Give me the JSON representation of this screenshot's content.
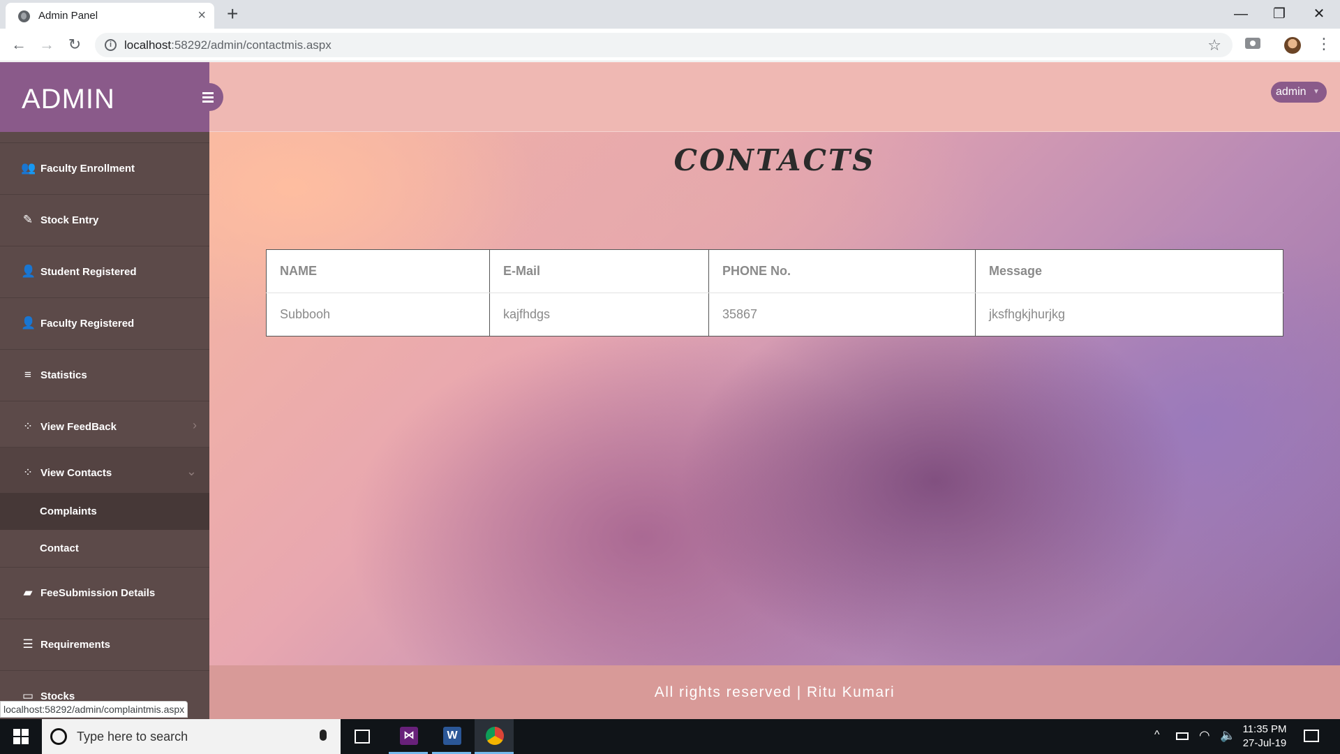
{
  "browser": {
    "tab_title": "Admin Panel",
    "tab_close": "×",
    "new_tab": "+",
    "window_min": "—",
    "window_max": "❐",
    "window_close": "✕",
    "back": "←",
    "forward": "→",
    "reload": "↻",
    "url_host": "localhost",
    "url_path": ":58292/admin/contactmis.aspx",
    "star": "☆",
    "menu": "⋮",
    "status_url": "localhost:58292/admin/complaintmis.aspx"
  },
  "sidebar": {
    "brand": "ADMIN",
    "items": [
      {
        "label": "Faculty Enrollment",
        "icon": "users-icon",
        "glyph": "👥"
      },
      {
        "label": "Stock Entry",
        "icon": "edit-icon",
        "glyph": "✎"
      },
      {
        "label": "Student Registered",
        "icon": "user-icon",
        "glyph": "👤"
      },
      {
        "label": "Faculty Registered",
        "icon": "user-plus-icon",
        "glyph": "👤"
      },
      {
        "label": "Statistics",
        "icon": "bars-icon",
        "glyph": "≡"
      },
      {
        "label": "View FeedBack",
        "icon": "grid-icon",
        "glyph": "⁘",
        "chevron": "›"
      },
      {
        "label": "View Contacts",
        "icon": "grid-icon",
        "glyph": "⁘",
        "chevron": "⌄"
      },
      {
        "label": "FeeSubmission Details",
        "icon": "book-icon",
        "glyph": "▰"
      },
      {
        "label": "Requirements",
        "icon": "list-icon",
        "glyph": "☰"
      },
      {
        "label": "Stocks",
        "icon": "briefcase-icon",
        "glyph": "▭"
      }
    ],
    "submenu": [
      {
        "label": "Complaints"
      },
      {
        "label": "Contact"
      }
    ]
  },
  "header": {
    "user": "admin",
    "caret": "▼"
  },
  "main": {
    "title": "CONTACTS",
    "table": {
      "columns": [
        "NAME",
        "E-Mail",
        "PHONE No.",
        "Message"
      ],
      "rows": [
        [
          "Subbooh",
          "kajfhdgs",
          "35867",
          "jksfhgkjhurjkg"
        ]
      ]
    }
  },
  "footer": {
    "text": "All rights reserved | Ritu Kumari"
  },
  "taskbar": {
    "search_placeholder": "Type here to search",
    "apps": [
      "visual-studio",
      "word",
      "chrome"
    ],
    "word_glyph": "W",
    "vs_glyph": "⋈",
    "tray_chevron": "^",
    "wifi": "◠",
    "volume": "🔈",
    "time": "11:35 PM",
    "date": "27-Jul-19"
  }
}
